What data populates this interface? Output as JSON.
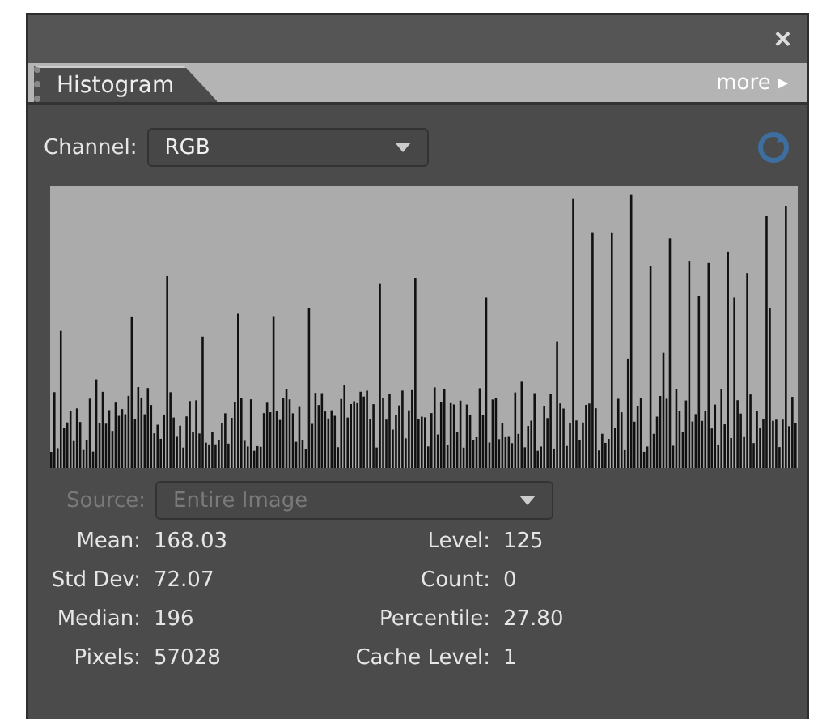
{
  "panel": {
    "close": "×"
  },
  "tab": {
    "label": "Histogram",
    "more": "more",
    "more_arrow": "▸"
  },
  "channel": {
    "label": "Channel:",
    "value": "RGB",
    "disabled": false
  },
  "source": {
    "label": "Source:",
    "value": "Entire Image",
    "disabled": true
  },
  "stats_left": [
    {
      "label": "Mean:",
      "value": "168.03"
    },
    {
      "label": "Std Dev:",
      "value": "72.07"
    },
    {
      "label": "Median:",
      "value": "196"
    },
    {
      "label": "Pixels:",
      "value": "57028"
    }
  ],
  "stats_right": [
    {
      "label": "Level:",
      "value": "125"
    },
    {
      "label": "Count:",
      "value": "0"
    },
    {
      "label": "Percentile:",
      "value": "27.80"
    },
    {
      "label": "Cache Level:",
      "value": "1"
    }
  ]
}
